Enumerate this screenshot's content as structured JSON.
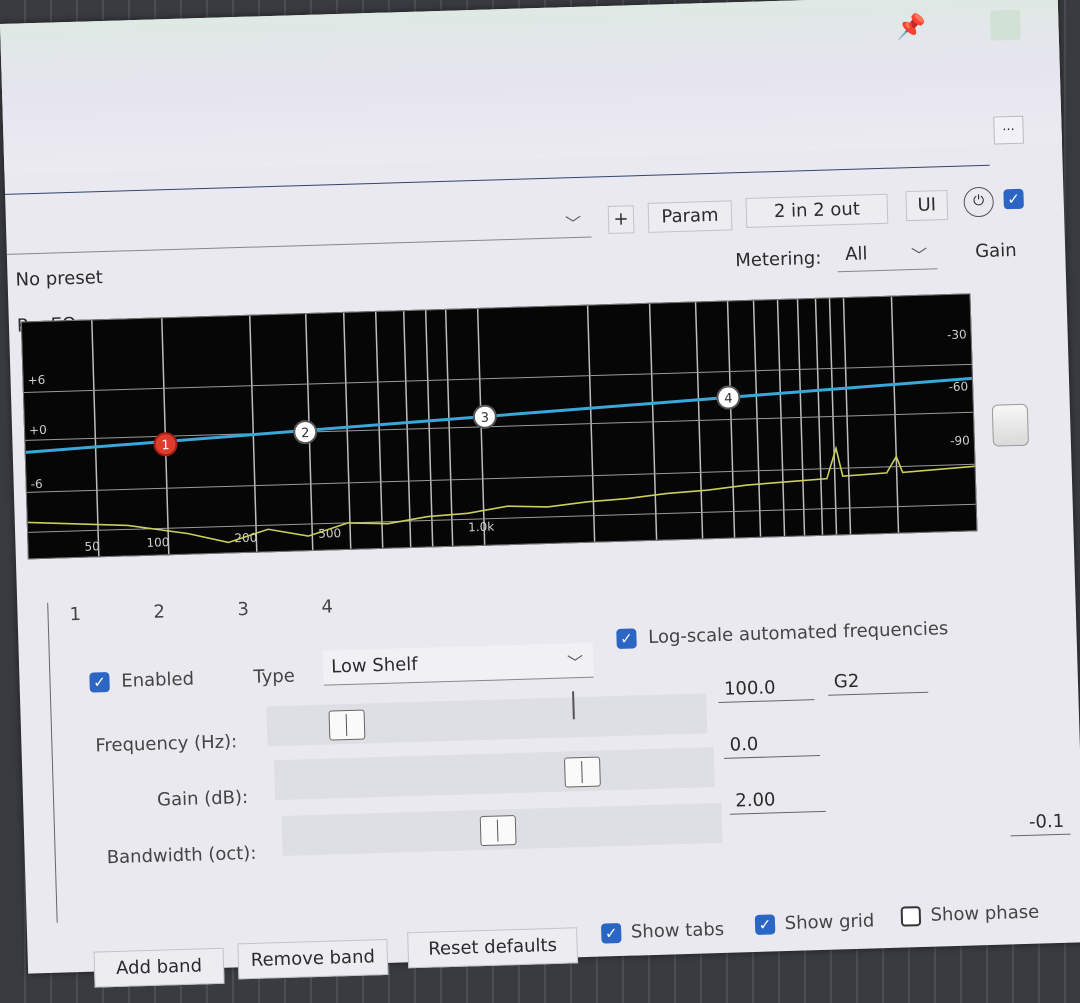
{
  "toolbar": {
    "more_label": "...",
    "preset_value": "No preset",
    "add_preset_label": "+",
    "param_label": "Param",
    "io_label": "2 in 2 out",
    "ui_label": "UI",
    "bypass_checked": true
  },
  "metering": {
    "label": "Metering:",
    "value": "All"
  },
  "gain_label": "Gain",
  "plugin_name": "ReaEQ",
  "graph": {
    "db_labels": [
      "+6",
      "+0",
      "-6"
    ],
    "right_labels": [
      "-30",
      "-60",
      "-90"
    ],
    "freq_labels": [
      "50",
      "100",
      "200",
      "500",
      "1.0k"
    ],
    "bands": [
      {
        "id": "1",
        "color": "#e23b2c",
        "selected": true
      },
      {
        "id": "2",
        "color": "#ffffff",
        "selected": false
      },
      {
        "id": "3",
        "color": "#ffffff",
        "selected": false
      },
      {
        "id": "4",
        "color": "#ffffff",
        "selected": false
      }
    ],
    "eq_curve_color": "#3aa7d8",
    "spectrum_color": "#c9cf5a"
  },
  "band_tabs": [
    "1",
    "2",
    "3",
    "4"
  ],
  "band": {
    "enabled_label": "Enabled",
    "enabled": true,
    "type_label": "Type",
    "type_value": "Low Shelf",
    "log_scale_label": "Log-scale automated frequencies",
    "log_scale": true,
    "frequency_label": "Frequency (Hz):",
    "frequency_value": "100.0",
    "note_value": "G2",
    "gain_label": "Gain (dB):",
    "gain_value": "0.0",
    "bandwidth_label": "Bandwidth (oct):",
    "bandwidth_value": "2.00",
    "output_gain_value": "-0.1"
  },
  "bottom": {
    "add_band": "Add band",
    "remove_band": "Remove band",
    "reset_defaults": "Reset defaults",
    "show_tabs": "Show tabs",
    "show_tabs_checked": true,
    "show_grid": "Show grid",
    "show_grid_checked": true,
    "show_phase": "Show phase",
    "show_phase_checked": false
  }
}
